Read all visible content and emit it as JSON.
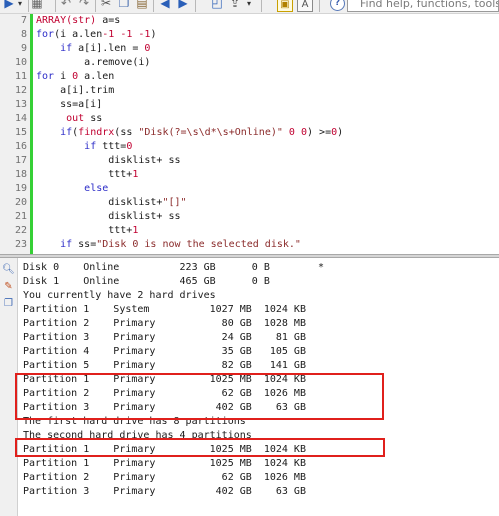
{
  "toolbar": {
    "help_placeholder": "Find help, functions, tools",
    "icons": [
      "play-arrow-icon",
      "dropdown-arrow-icon",
      "calculator-icon",
      "undo-icon",
      "redo-icon",
      "cut-icon",
      "copy-icon",
      "paste-icon",
      "back-icon",
      "forward-icon",
      "view-toggle-icon",
      "text-toggle-icon",
      "help-icon"
    ]
  },
  "editor": {
    "lines": [
      {
        "num": "7",
        "tokens": [
          {
            "t": "ARRAY(str)",
            "c": "fn"
          },
          {
            "t": " a=s",
            "c": "plain"
          }
        ]
      },
      {
        "num": "8",
        "tokens": [
          {
            "t": "for",
            "c": "kw"
          },
          {
            "t": "(i a.len",
            "c": "plain"
          },
          {
            "t": "-1",
            "c": "num"
          },
          {
            "t": " ",
            "c": "plain"
          },
          {
            "t": "-1",
            "c": "num"
          },
          {
            "t": " ",
            "c": "plain"
          },
          {
            "t": "-1",
            "c": "num"
          },
          {
            "t": ")",
            "c": "plain"
          }
        ]
      },
      {
        "num": "9",
        "tokens": [
          {
            "t": "    ",
            "c": "plain"
          },
          {
            "t": "if",
            "c": "kw"
          },
          {
            "t": " a[i].len = ",
            "c": "plain"
          },
          {
            "t": "0",
            "c": "num"
          }
        ]
      },
      {
        "num": "10",
        "tokens": [
          {
            "t": "        a.remove(i)",
            "c": "plain"
          }
        ]
      },
      {
        "num": "11",
        "tokens": [
          {
            "t": "for",
            "c": "kw"
          },
          {
            "t": " i ",
            "c": "plain"
          },
          {
            "t": "0",
            "c": "num"
          },
          {
            "t": " a.len",
            "c": "plain"
          }
        ]
      },
      {
        "num": "12",
        "tokens": [
          {
            "t": "    a[i].trim",
            "c": "plain"
          }
        ]
      },
      {
        "num": "13",
        "tokens": [
          {
            "t": "    ss=a[i]",
            "c": "plain"
          }
        ]
      },
      {
        "num": "14",
        "tokens": [
          {
            "t": "     ",
            "c": "plain"
          },
          {
            "t": "out",
            "c": "fn"
          },
          {
            "t": " ss",
            "c": "plain"
          }
        ]
      },
      {
        "num": "15",
        "tokens": [
          {
            "t": "    ",
            "c": "plain"
          },
          {
            "t": "if",
            "c": "kw"
          },
          {
            "t": "(",
            "c": "plain"
          },
          {
            "t": "findrx",
            "c": "fn"
          },
          {
            "t": "(ss ",
            "c": "plain"
          },
          {
            "t": "\"Disk(?=\\s\\d*\\s+Online)\"",
            "c": "str"
          },
          {
            "t": " ",
            "c": "plain"
          },
          {
            "t": "0",
            "c": "num"
          },
          {
            "t": " ",
            "c": "plain"
          },
          {
            "t": "0",
            "c": "num"
          },
          {
            "t": ") >=",
            "c": "plain"
          },
          {
            "t": "0",
            "c": "num"
          },
          {
            "t": ")",
            "c": "plain"
          }
        ]
      },
      {
        "num": "16",
        "tokens": [
          {
            "t": "        ",
            "c": "plain"
          },
          {
            "t": "if",
            "c": "kw"
          },
          {
            "t": " ttt=",
            "c": "plain"
          },
          {
            "t": "0",
            "c": "num"
          }
        ]
      },
      {
        "num": "17",
        "tokens": [
          {
            "t": "            disklist+ ss",
            "c": "plain"
          }
        ]
      },
      {
        "num": "18",
        "tokens": [
          {
            "t": "            ttt+",
            "c": "plain"
          },
          {
            "t": "1",
            "c": "num"
          }
        ]
      },
      {
        "num": "19",
        "tokens": [
          {
            "t": "        ",
            "c": "plain"
          },
          {
            "t": "else",
            "c": "kw"
          }
        ]
      },
      {
        "num": "20",
        "tokens": [
          {
            "t": "            disklist+",
            "c": "plain"
          },
          {
            "t": "\"[]\"",
            "c": "str"
          }
        ]
      },
      {
        "num": "21",
        "tokens": [
          {
            "t": "            disklist+ ss",
            "c": "plain"
          }
        ]
      },
      {
        "num": "22",
        "tokens": [
          {
            "t": "            ttt+",
            "c": "plain"
          },
          {
            "t": "1",
            "c": "num"
          }
        ]
      },
      {
        "num": "23",
        "tokens": [
          {
            "t": "    ",
            "c": "plain"
          },
          {
            "t": "if",
            "c": "kw"
          },
          {
            "t": " ss=",
            "c": "plain"
          },
          {
            "t": "\"Disk 0 is now the selected disk.\"",
            "c": "str"
          }
        ]
      }
    ]
  },
  "output": {
    "side_icons": [
      "find-icon",
      "clear-icon",
      "copy-icon"
    ],
    "lines": [
      "Disk 0    Online          223 GB      0 B        *",
      "Disk 1    Online          465 GB      0 B",
      "You currently have 2 hard drives",
      "Partition 1    System          1027 MB  1024 KB",
      "Partition 2    Primary           80 GB  1028 MB",
      "Partition 3    Primary           24 GB    81 GB",
      "Partition 4    Primary           35 GB   105 GB",
      "Partition 5    Primary           82 GB   141 GB",
      "Partition 1    Primary         1025 MB  1024 KB",
      "Partition 2    Primary           62 GB  1026 MB",
      "Partition 3    Primary          402 GB    63 GB",
      "The first hard drive has 8 partitions",
      "The second hard drive has 4 partitions",
      "Partition 1    Primary         1025 MB  1024 KB",
      "Partition 1    Primary         1025 MB  1024 KB",
      "Partition 2    Primary           62 GB  1026 MB",
      "Partition 3    Primary          402 GB    63 GB"
    ],
    "highlight_color": "#e0201c"
  }
}
